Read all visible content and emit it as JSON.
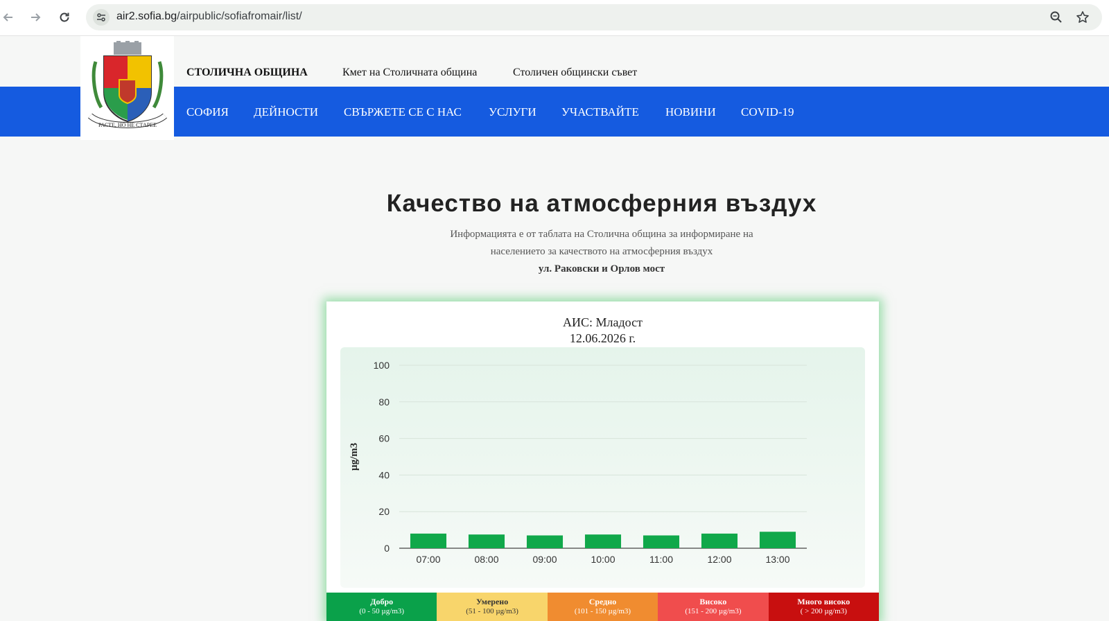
{
  "browser": {
    "url_host": "air2.sofia.bg",
    "url_path": "/airpublic/sofiafromair/list/"
  },
  "header": {
    "org_name": "СТОЛИЧНА ОБЩИНА",
    "links": [
      "Кмет на Столичната община",
      "Столичен общински съвет"
    ],
    "menu": [
      "СОФИЯ",
      "ДЕЙНОСТИ",
      "СВЪРЖЕТЕ СЕ С НАС",
      "УСЛУГИ",
      "УЧАСТВАЙТЕ",
      "НОВИНИ",
      "COVID-19"
    ],
    "logo_motto": "РАСТЕ, НО НЕ СТАРЕЕ",
    "brand_color": "#155be0"
  },
  "main": {
    "title": "Качество на атмосферния въздух",
    "subtitle_lines": [
      "Информацията е от таблата на Столична община за информиране на",
      "населението за качеството на атмосферния въздух"
    ],
    "location": "ул. Раковски и Орлов мост"
  },
  "chart_data": {
    "type": "bar",
    "title_lines": [
      "АИС: Младост",
      "12.06.2026 г."
    ],
    "ylabel": "µg/m3",
    "categories": [
      "07:00",
      "08:00",
      "09:00",
      "10:00",
      "11:00",
      "12:00",
      "13:00"
    ],
    "values": [
      8,
      7.5,
      7,
      7.5,
      7,
      8,
      9
    ],
    "ylim": [
      0,
      100
    ],
    "yticks": [
      0,
      20,
      40,
      60,
      80,
      100
    ],
    "grid": true,
    "bar_color": "#10a84a"
  },
  "legend": [
    {
      "label": "Добро",
      "range": "(0 - 50 µg/m3)",
      "bg": "#0aa14a",
      "fg": "#ffffff"
    },
    {
      "label": "Умерено",
      "range": "(51 - 100 µg/m3)",
      "bg": "#f8d56b",
      "fg": "#333333"
    },
    {
      "label": "Средно",
      "range": "(101 - 150 µg/m3)",
      "bg": "#f08c30",
      "fg": "#ffffff"
    },
    {
      "label": "Високо",
      "range": "(151 - 200 µg/m3)",
      "bg": "#f04d4d",
      "fg": "#ffffff"
    },
    {
      "label": "Много високо",
      "range": "( > 200 µg/m3)",
      "bg": "#c80f0f",
      "fg": "#ffffff"
    }
  ]
}
